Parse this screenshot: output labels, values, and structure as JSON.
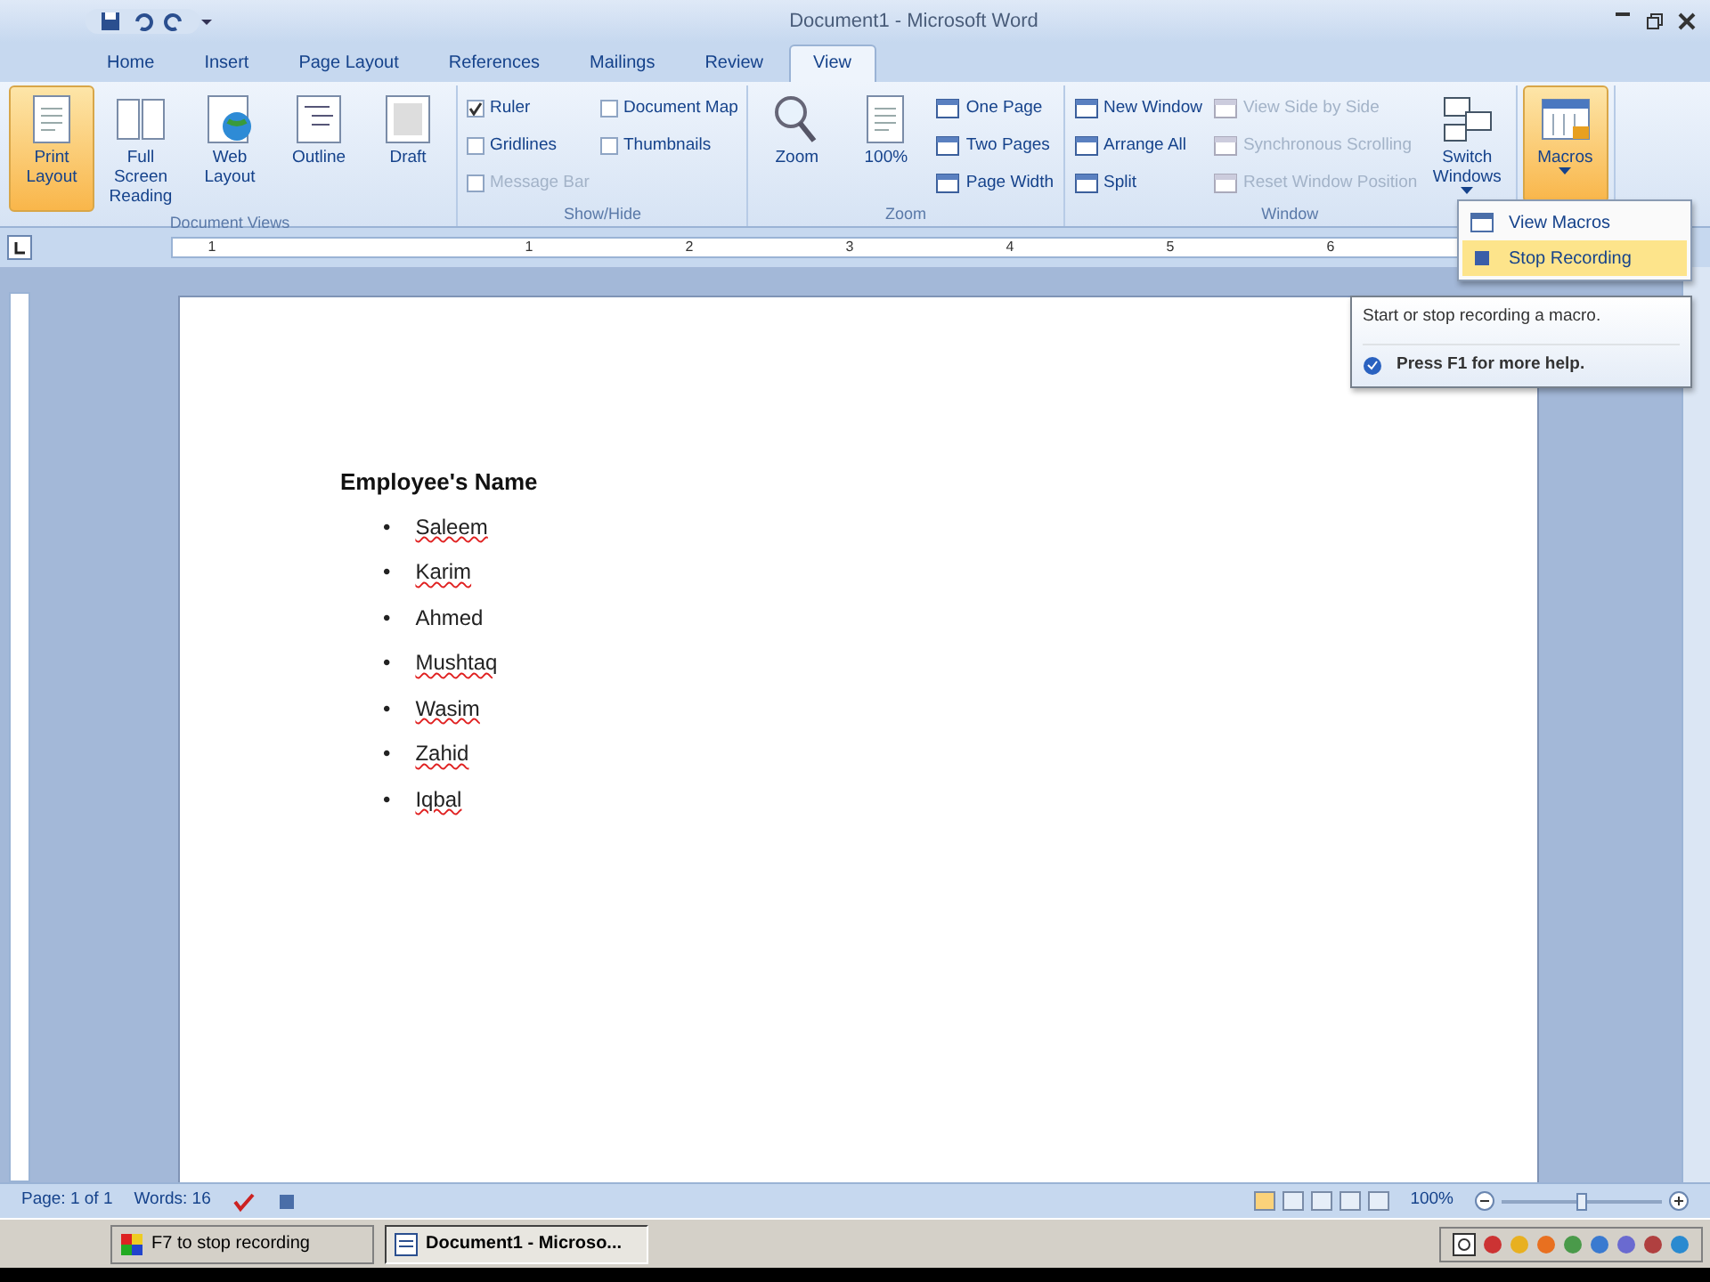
{
  "window": {
    "title": "Document1 - Microsoft Word"
  },
  "tabs": [
    {
      "label": "Home",
      "selected": false
    },
    {
      "label": "Insert",
      "selected": false
    },
    {
      "label": "Page Layout",
      "selected": false
    },
    {
      "label": "References",
      "selected": false
    },
    {
      "label": "Mailings",
      "selected": false
    },
    {
      "label": "Review",
      "selected": false
    },
    {
      "label": "View",
      "selected": true
    }
  ],
  "ribbon_groups": [
    {
      "label": "Document Views",
      "items": [
        {
          "kind": "big",
          "label": "Print Layout",
          "selected": true
        },
        {
          "kind": "big",
          "label": "Full Screen Reading",
          "selected": false
        },
        {
          "kind": "big",
          "label": "Web Layout",
          "selected": false
        },
        {
          "kind": "big",
          "label": "Outline",
          "selected": false
        },
        {
          "kind": "big",
          "label": "Draft",
          "selected": false
        }
      ]
    },
    {
      "label": "Show/Hide",
      "items": [
        {
          "kind": "check",
          "label": "Ruler",
          "checked": true,
          "disabled": false
        },
        {
          "kind": "check",
          "label": "Gridlines",
          "checked": false,
          "disabled": false
        },
        {
          "kind": "check",
          "label": "Message Bar",
          "checked": false,
          "disabled": true
        },
        {
          "kind": "check",
          "label": "Document Map",
          "checked": false,
          "disabled": false
        },
        {
          "kind": "check",
          "label": "Thumbnails",
          "checked": false,
          "disabled": false
        }
      ]
    },
    {
      "label": "Zoom",
      "items": [
        {
          "kind": "big",
          "label": "Zoom",
          "selected": false
        },
        {
          "kind": "big",
          "label": "100%",
          "selected": false
        },
        {
          "kind": "small",
          "label": "One Page",
          "disabled": false
        },
        {
          "kind": "small",
          "label": "Two Pages",
          "disabled": false
        },
        {
          "kind": "small",
          "label": "Page Width",
          "disabled": false
        }
      ]
    },
    {
      "label": "Window",
      "items": [
        {
          "kind": "small",
          "label": "New Window",
          "disabled": false
        },
        {
          "kind": "small",
          "label": "Arrange All",
          "disabled": false
        },
        {
          "kind": "small",
          "label": "Split",
          "disabled": false
        },
        {
          "kind": "small",
          "label": "View Side by Side",
          "disabled": true
        },
        {
          "kind": "small",
          "label": "Synchronous Scrolling",
          "disabled": true
        },
        {
          "kind": "small",
          "label": "Reset Window Position",
          "disabled": true
        },
        {
          "kind": "big",
          "label": "Switch Windows",
          "selected": false,
          "dropdown": true
        }
      ]
    },
    {
      "items": [
        {
          "kind": "big",
          "label": "Macros",
          "selected": true,
          "dropdown": true
        }
      ]
    }
  ],
  "macros_menu": [
    {
      "label": "View Macros",
      "selected": false
    },
    {
      "label": "Stop Recording",
      "selected": true
    }
  ],
  "tooltip": {
    "text": "Start or stop recording a macro.",
    "help": "Press F1 for more help."
  },
  "ruler": [
    "1",
    "1",
    "2",
    "3",
    "4",
    "5",
    "6"
  ],
  "document": {
    "heading": "Employee's Name",
    "items": [
      {
        "bullet": "•",
        "text": "Saleem",
        "misspelled": true
      },
      {
        "bullet": "•",
        "text": "Karim",
        "misspelled": true
      },
      {
        "bullet": "•",
        "text": "Ahmed",
        "misspelled": false
      },
      {
        "bullet": "•",
        "text": "Mushtaq",
        "misspelled": true
      },
      {
        "bullet": "•",
        "text": "Wasim",
        "misspelled": true
      },
      {
        "bullet": "•",
        "text": "Zahid",
        "misspelled": true
      },
      {
        "bullet": "•",
        "text": "Iqbal",
        "misspelled": true
      }
    ]
  },
  "status_bar": {
    "page": "Page: 1 of 1",
    "words": "Words: 16",
    "zoom": "100%",
    "zoom_slider": {
      "level": 0.5
    }
  },
  "taskbar": {
    "items": [
      {
        "label": "F7 to stop recording",
        "selected": false
      },
      {
        "label": "Document1 - Microso...",
        "selected": true
      }
    ]
  }
}
